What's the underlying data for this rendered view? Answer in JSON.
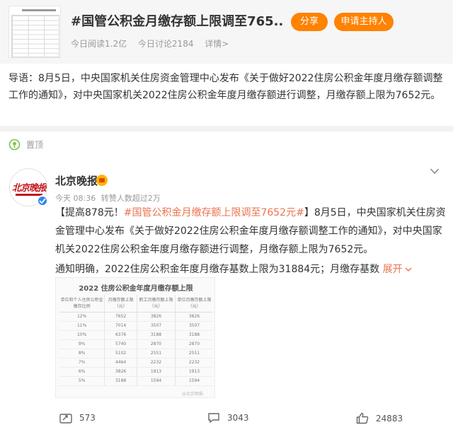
{
  "topic": {
    "title": "#国管公积金月缴存额上限调至765...",
    "reads": "今日阅读1.2亿",
    "discussions": "今日讨论2184",
    "details": "详情>",
    "share_label": "分享",
    "host_label": "申请主持人"
  },
  "intro": {
    "text": "导语：8月5日，中央国家机关住房资金管理中心发布《关于做好2022住房公积金年度月缴存额调整工作的通知》，对中央国家机关2022住房公积金年度月缴存额进行调整，月缴存额上限为7652元。"
  },
  "pinned": {
    "label": "置顶"
  },
  "post": {
    "author": "北京晚报",
    "avatar_text": "北京晚报",
    "time": "今天 08:36",
    "reposts_info": "转赞人数超过2万",
    "line1_prefix": "【提高878元！",
    "line1_tag": "#国管公积金月缴存额上限调至7652元#",
    "line1_suffix": "】8月5日，中央国家机关住房资金管理中心发布《关于做好2022住房公积金年度月缴存额调整工作的通知》，对中央国家机关2022住房公积金年度月缴存额进行调整，月缴存额上限为7652元。",
    "line2": "通知明确，2022住房公积金年度月缴存基数上限为31884元；月缴存基数",
    "expand_label": "展开",
    "image": {
      "title": "2022 住房公积金年度月缴存额上限",
      "headers": [
        "单位和个人住房公积金缴存比例",
        "月缴存额上限（元）",
        "职工月缴存额上限（元）",
        "单位月缴存额上限（元）"
      ],
      "rows": [
        [
          "12%",
          "7652",
          "3826",
          "3826"
        ],
        [
          "11%",
          "7014",
          "3507",
          "3507"
        ],
        [
          "10%",
          "6376",
          "3188",
          "3188"
        ],
        [
          "9%",
          "5740",
          "2870",
          "2870"
        ],
        [
          "8%",
          "5102",
          "2551",
          "2551"
        ],
        [
          "7%",
          "4464",
          "2232",
          "2232"
        ],
        [
          "6%",
          "3826",
          "1913",
          "1913"
        ],
        [
          "5%",
          "3188",
          "1594",
          "1594"
        ]
      ]
    }
  },
  "actions": {
    "reposts": "573",
    "comments": "3043",
    "likes": "24883"
  },
  "colors": {
    "brand_orange": "#ff8200",
    "link_orange": "#eb7350",
    "verified_blue": "#2c87ee"
  }
}
